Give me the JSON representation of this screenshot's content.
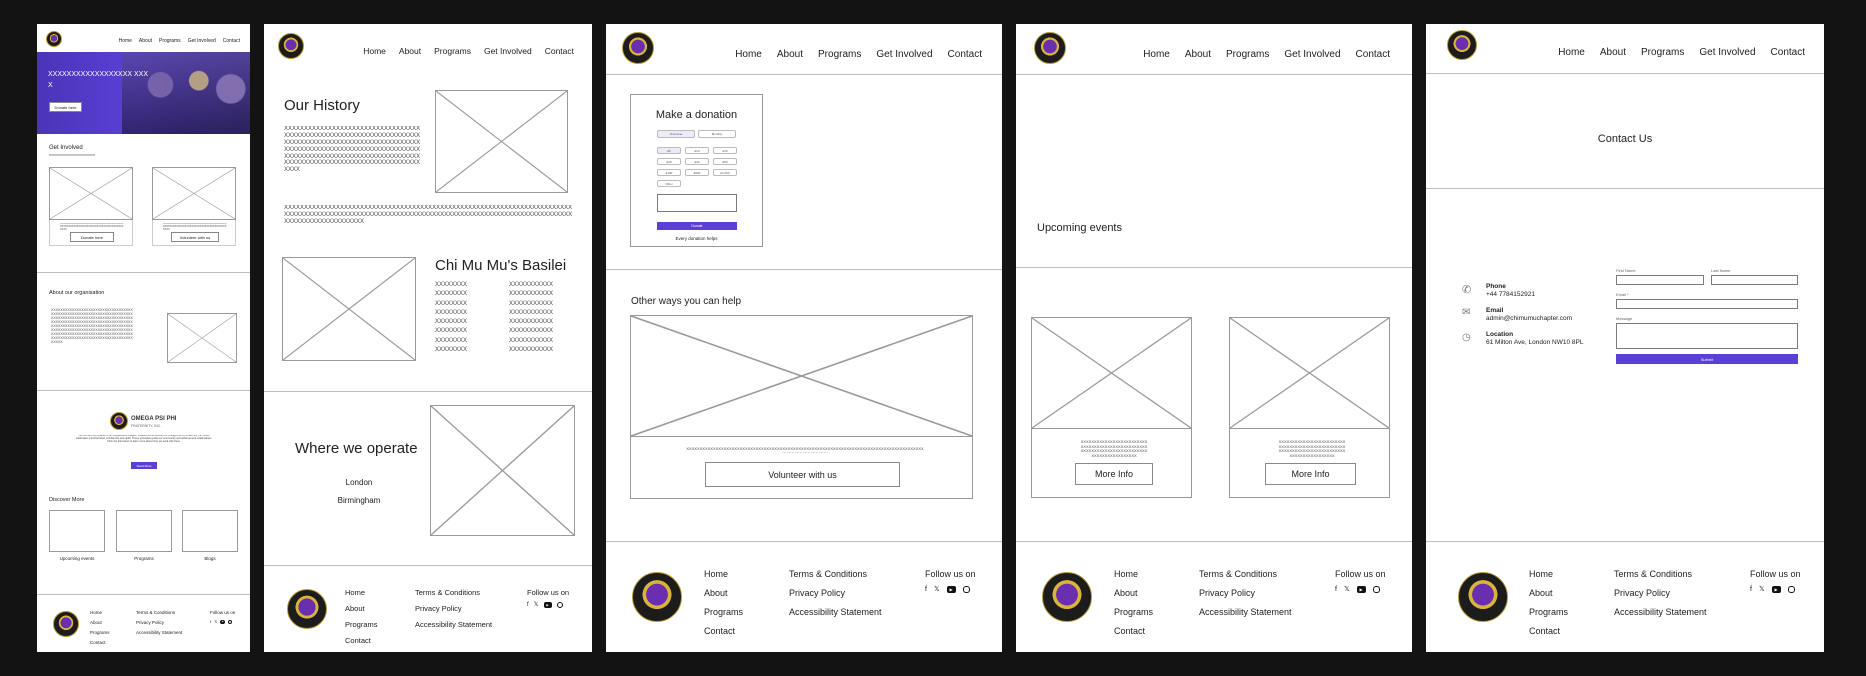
{
  "nav": [
    "Home",
    "About",
    "Programs",
    "Get Involved",
    "Contact"
  ],
  "footer": {
    "col1": [
      "Home",
      "About",
      "Programs",
      "Contact"
    ],
    "col2": [
      "Terms & Conditions",
      "Privacy Policy",
      "Accessibility Statement"
    ],
    "follow": "Follow us on",
    "social_icons": [
      "facebook-icon",
      "x-icon",
      "youtube-icon",
      "instagram-icon"
    ]
  },
  "colors": {
    "accent": "#5b3fd6",
    "hero": "#4b34b8"
  },
  "home": {
    "hero_text": "XXXXXXXXXXXXXXXXXX XXXX",
    "hero_button": "Donate here",
    "get_involved_title": "Get Involved",
    "get_involved_sub": "XXXXXXXXXXXXXXXXXXXXXXX",
    "card_text": "XXXXXXXXXXXXXXXXXXXXXXXXXXXXXXXXXXXXXXXXXXXXXXXXXXXXXXXXXXXXXXXXXXXXXXXXXXXXXXXX",
    "card1_button": "Donate here",
    "card2_button": "Volunteer with us",
    "about_title": "About our organisation",
    "about_text": "XXXXXXXXXXXXXXXXXXXXXXXXXXXXXXXXXXXXXXXXXXXXXXXXXXXXXXXXXXXXXXXXXXXXXXXXXXXXXXXXXXXXXXXXXXXXXXXXXXXXXXXXXXXXXXXXXXXXXXXXXXXXXXXXXXXXXXXXXXXXXXXXXXXXXXXXXXXXXXXXXXXXXXXXXXXXXXXXXXXXXXXXXXXXXXXXXXXXXXXXXXXXXXXXXXXXXXXXXXXXXXXXXXXXXXXXXXXXXXXXXXXXXXXXXXXXXXXXXXXXXXXXXXXXXXXXXXXXXXXXXXXXX",
    "brand_name": "OMEGA PSI PHI",
    "brand_sub": "FRATERNITY, INC.",
    "brand_desc": "The Chi Mu Mu Chapter is an independent chapter, initiated at the direction of Omega Psi Phi Fraternity, Inc. which celebrates a brotherhood, scholarship and uplift. These principles guide our community and achievement relationships. Click the link below to learn more about how we work with them.",
    "brand_button": "Read More",
    "discover_title": "Discover More",
    "discover": [
      "Upcoming events",
      "Programs",
      "Blogs"
    ]
  },
  "about": {
    "history_title": "Our History",
    "history_text": "XXXXXXXXXXXXXXXXXXXXXXXXXXXXXXXXXXXXXXXXXXXXXXXXXXXXXXXXXXXXXXXXXXXXXXXXXXXXXXXXXXXXXXXXXXXXXXXXXXXXXXXXXXXXXXXXXXXXXXXXXXXXXXXXXXXXXXXXXXXXXXXXXXXXXXXXXXXXXXXXXXXXXXXXXXXXXXXXXXXXXXXXXXXXXXXXXXXXXXXXXXXXXXXX",
    "history_text2": "XXXXXXXXXXXXXXXXXXXXXXXXXXXXXXXXXXXXXXXXXXXXXXXXXXXXXXXXXXXXXXXXXXXXXXXXXXXXXXXXXXXXXXXXXXXXXXXXXXXXXXXXXXXXXXXXXXXXXXXXXXXXXXXXXXXXXXXXXXXXXXXXXXXXXXXXXXXXXXXXXXXX",
    "basilei_title": "Chi Mu Mu's Basilei",
    "basilei_col1": "XXXXXXXX XXXXXXXX XXXXXXXX XXXXXXXX XXXXXXXX XXXXXXXX XXXXXXXX XXXXXXXX",
    "basilei_col2": "XXXXXXXXXXX XXXXXXXXXXX XXXXXXXXXXX XXXXXXXXXXX XXXXXXXXXXX XXXXXXXXXXX XXXXXXXXXXX XXXXXXXXXXX",
    "operate_title": "Where we operate",
    "locations": [
      "London",
      "Birmingham"
    ]
  },
  "donate": {
    "title": "Make a donation",
    "frequency": [
      "One-time",
      "Monthly"
    ],
    "amounts": [
      "£5",
      "£10",
      "£15",
      "£20",
      "£30",
      "£50",
      "£100",
      "£500",
      "£1,000"
    ],
    "other": "Other",
    "button": "Donate",
    "note": "Every donation helps",
    "other_ways_title": "Other ways you can help",
    "other_ways_text": "XXXXXXXXXXXXXXXXXXXXXXXXXXXXXXXXXXXXXXXXXXXXXXXXXXXXXXXXXXXXXXXXXXXXXXXXXXXXXXXXXXXXXXXXXXXXXXXXXXXXXXXXXX",
    "volunteer_button": "Volunteer with us"
  },
  "events": {
    "title": "Upcoming events",
    "card_text": "XXXXXXXXXXXXXXXXXXXXXXXXXXXXXXXXXXXXXXXXXXXXXXXXXXXXXXXXXXXXXXXXXXXXXXXXXXXXXXXXXXXXXXXXXXXX",
    "more_info": "More Info"
  },
  "contact": {
    "title": "Contact Us",
    "phone_label": "Phone",
    "phone_value": "+44 7784152921",
    "email_label": "Email",
    "email_value": "admin@chimumuchapter.com",
    "location_label": "Location",
    "location_value": "61 Milton Ave, London NW10 8PL",
    "first_name": "First Name",
    "last_name": "Last Name",
    "email_field": "Email *",
    "message": "Message",
    "submit": "Submit"
  }
}
